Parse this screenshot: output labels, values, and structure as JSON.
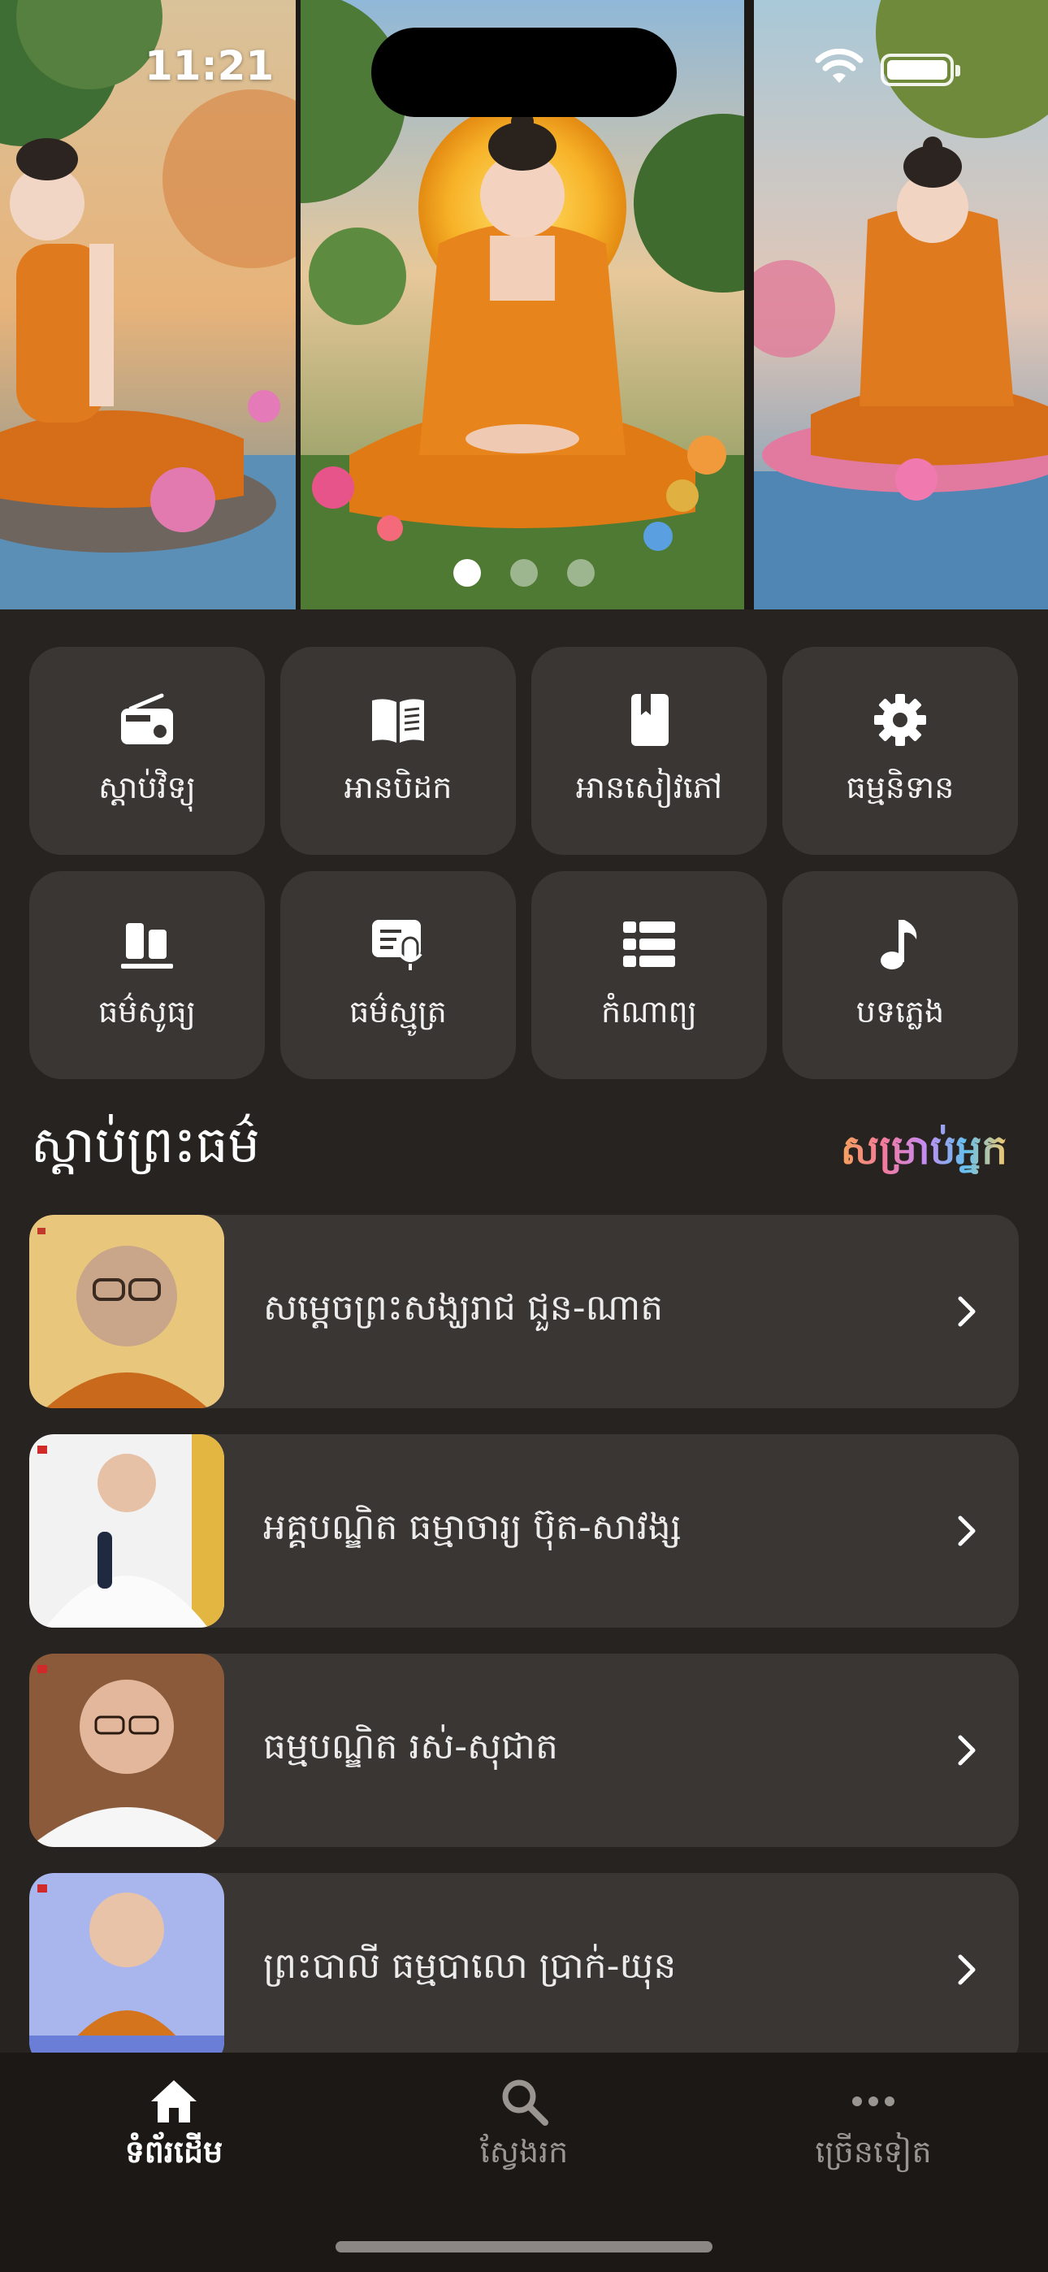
{
  "status_bar": {
    "time": "11:21"
  },
  "carousel": {
    "slide_count": 3,
    "active_index": 0
  },
  "menu": [
    {
      "label": "ស្តាប់វិទ្យុ",
      "icon": "radio-icon"
    },
    {
      "label": "អានបិដក",
      "icon": "open-book-icon"
    },
    {
      "label": "អានសៀវភៅ",
      "icon": "book-icon"
    },
    {
      "label": "ធម្មនិទាន",
      "icon": "gear-icon"
    },
    {
      "label": "ធម៌សូធ្យ",
      "icon": "library-icon"
    },
    {
      "label": "ធម៌ស្មូត្រ",
      "icon": "podcast-icon"
    },
    {
      "label": "កំណាព្យ",
      "icon": "list-icon"
    },
    {
      "label": "បទភ្លេង",
      "icon": "music-note-icon"
    }
  ],
  "section": {
    "title": "ស្តាប់ព្រះធម៌",
    "tag": "សម្រាប់អ្នក"
  },
  "preachers": [
    {
      "name": "សម្តេចព្រះសង្ឃរាជ ជួន-ណាត"
    },
    {
      "name": "អគ្គបណ្ឌិត ធម្មាចារ្យ ប៊ុត-សាវង្ស"
    },
    {
      "name": "ធម្មបណ្ឌិត រស់-សុជាត"
    },
    {
      "name": "ព្រះបាលី ធម្មបាលោ ប្រាក់-យុន"
    }
  ],
  "nav": {
    "home": "ទំព័រដើម",
    "search": "ស្វែងរក",
    "more": "ច្រើនទៀត"
  },
  "colors": {
    "background": "#272320",
    "tile": "#3a3633",
    "navbar": "#1b1816",
    "robe": "#e27a1c"
  }
}
